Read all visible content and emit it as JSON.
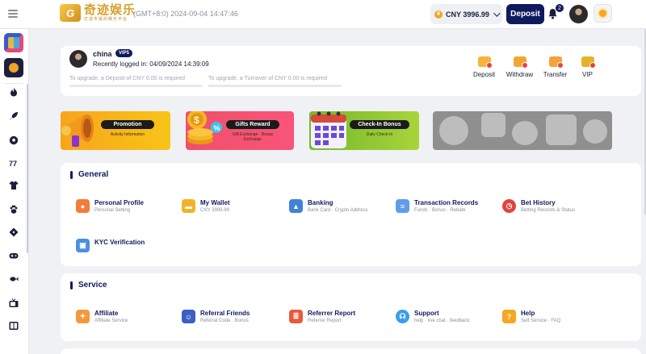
{
  "header": {
    "logo_mark": "G",
    "logo_name": "奇迹娱乐",
    "logo_tagline": "打造专属的娱乐平台",
    "clock": "(GMT+8:0) 2024-09-04 14:47:46",
    "balance": "CNY 3996.99",
    "currency_symbol": "¥",
    "deposit_label": "Deposit",
    "notification_count": "2",
    "accent_color": "#0f1a5e"
  },
  "sidebar": {
    "icons": [
      "hamburger-icon",
      "slots-game-tile",
      "sports-game-tile",
      "hot-icon",
      "rocket-icon",
      "soccer-icon",
      "number-game-icon",
      "jersey-icon",
      "paw-icon",
      "dice-icon",
      "gamepad-icon",
      "fish-icon",
      "tv-icon",
      "cards-icon"
    ]
  },
  "profile": {
    "username": "china",
    "vip_level": "VIP5",
    "last_login": "Recently logged in: 04/09/2024 14:39:09",
    "deposit_requirement": "To upgrade, a Deposit of CNY 0.00 is required",
    "turnover_requirement": "To upgrade, a Turnover of CNY 0.00 is required",
    "quick_actions": [
      {
        "label": "Deposit",
        "icon": "deposit-icon"
      },
      {
        "label": "Withdraw",
        "icon": "withdraw-icon"
      },
      {
        "label": "Transfer",
        "icon": "transfer-icon"
      },
      {
        "label": "VIP",
        "icon": "vip-icon"
      }
    ]
  },
  "banners": [
    {
      "title": "Promotion",
      "subtitle": "Activity Information"
    },
    {
      "title": "Gifts Reward",
      "subtitle": "Gift Exchange · Bonus Exchange"
    },
    {
      "title": "Check-In Bonus",
      "subtitle": "Daily Check-In"
    }
  ],
  "general": {
    "title": "General",
    "items": [
      {
        "title": "Personal Profile",
        "subtitle": "Personal Setting"
      },
      {
        "title": "My Wallet",
        "subtitle": "CNY 3996.99"
      },
      {
        "title": "Banking",
        "subtitle": "Bank Card · Crypto Address"
      },
      {
        "title": "Transaction Records",
        "subtitle": "Funds · Bonus · Rebate"
      },
      {
        "title": "Bet History",
        "subtitle": "Betting Records & Status"
      },
      {
        "title": "KYC Verification",
        "subtitle": ""
      }
    ]
  },
  "service": {
    "title": "Service",
    "items": [
      {
        "title": "Affiliate",
        "subtitle": "Affiliate Service"
      },
      {
        "title": "Referral Friends",
        "subtitle": "Referral Code · Bonus"
      },
      {
        "title": "Referrer Report",
        "subtitle": "Referrer Report"
      },
      {
        "title": "Support",
        "subtitle": "help · live chat · feedback"
      },
      {
        "title": "Help",
        "subtitle": "Self Service · FAQ"
      }
    ]
  }
}
